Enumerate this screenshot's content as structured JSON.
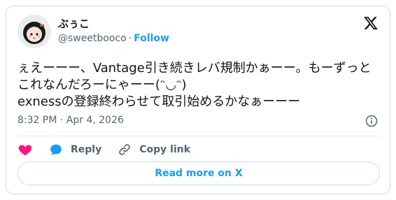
{
  "author": {
    "display_name": "ぶぅこ",
    "handle": "@sweetbooco",
    "separator": "·",
    "follow_label": "Follow"
  },
  "tweet": {
    "text": "ぇえーーー、Vantage引き続きレバ規制かぁーー。もーずっとこれなんだろーにゃーー(ᵔ◡ᵔ)\nexnessの登録終わらせて取引始めるかなぁーーー",
    "time": "8:32 PM",
    "separator": "·",
    "date": "Apr 4, 2026"
  },
  "actions": {
    "like_icon": "heart-icon",
    "reply_label": "Reply",
    "copy_link_label": "Copy link"
  },
  "footer": {
    "read_more_label": "Read more on X"
  },
  "colors": {
    "accent": "#1d9bf0",
    "like": "#f91880",
    "text_secondary": "#536471",
    "border": "#cfd9de"
  }
}
